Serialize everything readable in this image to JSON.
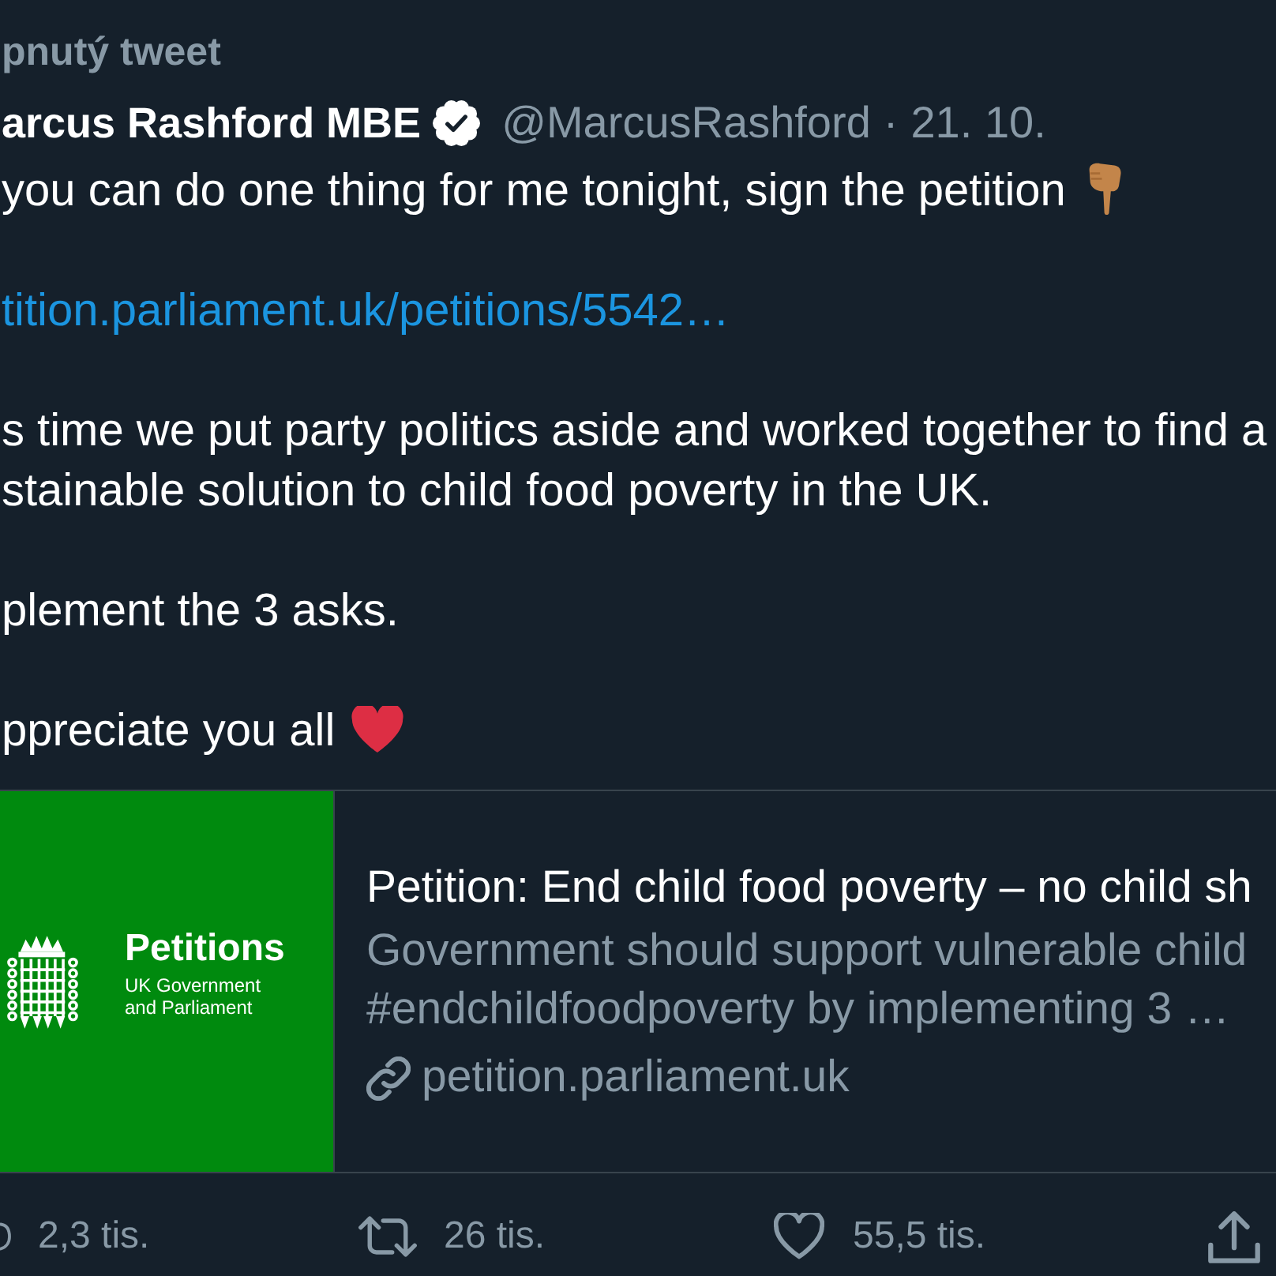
{
  "pinned_label": "pnutý tweet",
  "tweet": {
    "author_name": "arcus Rashford MBE",
    "verified": true,
    "handle": "@MarcusRashford",
    "separator": "·",
    "date": "21. 10.",
    "paragraphs": [
      {
        "kind": "text",
        "lines": [
          "you can do one thing for me tonight, sign the petition"
        ],
        "emoji": {
          "kind": "pointing_down"
        }
      },
      {
        "kind": "link",
        "lines": [
          "tition.parliament.uk/petitions/5542…"
        ]
      },
      {
        "kind": "text",
        "lines": [
          "s time we put party politics aside and worked together to find a",
          "stainable solution to child food poverty in the UK."
        ]
      },
      {
        "kind": "text",
        "lines": [
          "plement the 3 asks."
        ]
      },
      {
        "kind": "text",
        "lines": [
          "ppreciate you all"
        ],
        "emoji": {
          "kind": "heart"
        }
      }
    ]
  },
  "link_card": {
    "image": {
      "title": "Petitions",
      "subtitle_lines": [
        "UK Government",
        "and Parliament"
      ]
    },
    "title": "Petition: End child food poverty – no child sh",
    "description_lines": [
      "Government should support vulnerable child",
      "#endchildfoodpoverty by implementing 3 …"
    ],
    "domain": "petition.parliament.uk"
  },
  "actions": [
    {
      "kind": "reply",
      "count": "2,3 tis."
    },
    {
      "kind": "retweet",
      "count": "26 tis."
    },
    {
      "kind": "like",
      "count": "55,5 tis."
    },
    {
      "kind": "share"
    }
  ]
}
